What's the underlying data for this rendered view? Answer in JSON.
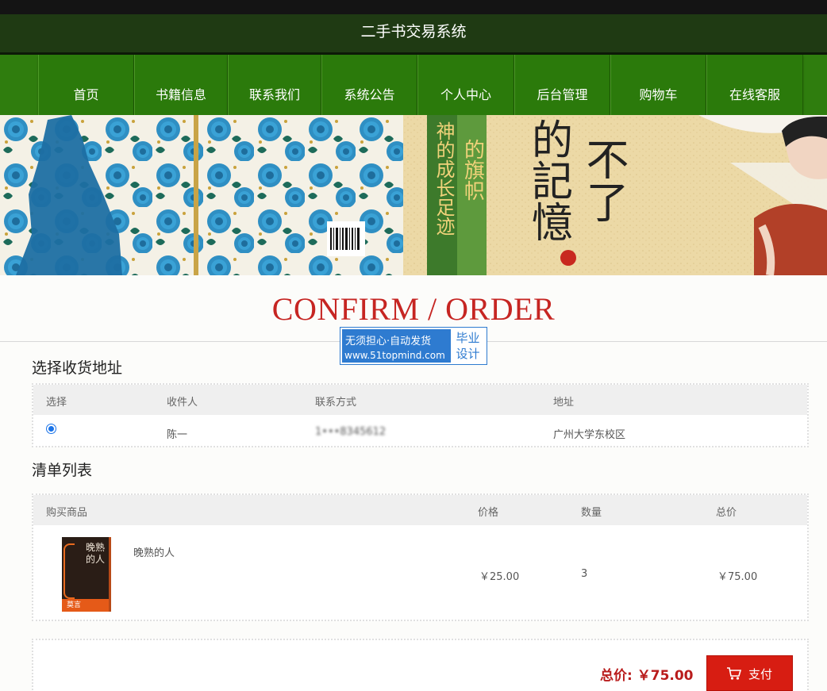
{
  "site_title": "二手书交易系统",
  "nav": [
    "首页",
    "书籍信息",
    "联系我们",
    "系统公告",
    "个人中心",
    "后台管理",
    "购物车",
    "在线客服"
  ],
  "banner": {
    "text_a": "的旗帜",
    "text_b": "神的成长足迹",
    "text_c": "的記憶",
    "text_d": "不了"
  },
  "page_heading": "CONFIRM / ORDER",
  "watermark": {
    "line1": "无须担心·自动发货",
    "line2": "www.51topmind.com",
    "badge1": "毕业",
    "badge2": "设计"
  },
  "address_section": {
    "title": "选择收货地址",
    "headers": [
      "选择",
      "收件人",
      "联系方式",
      "地址"
    ],
    "rows": [
      {
        "recipient": "陈一",
        "phone": "1•••8345612",
        "address": "广州大学东校区",
        "selected": true
      }
    ]
  },
  "order_section": {
    "title": "清单列表",
    "headers": [
      "购买商品",
      "价格",
      "数量",
      "总价"
    ],
    "items": [
      {
        "name": "晚熟的人",
        "price": "￥25.00",
        "quantity": "3",
        "total": "￥75.00",
        "cover_title": "晚熟的人",
        "cover_author": "莫言"
      }
    ]
  },
  "summary": {
    "total_label": "总价:",
    "total_value": "￥75.00",
    "pay_button": "支付"
  }
}
